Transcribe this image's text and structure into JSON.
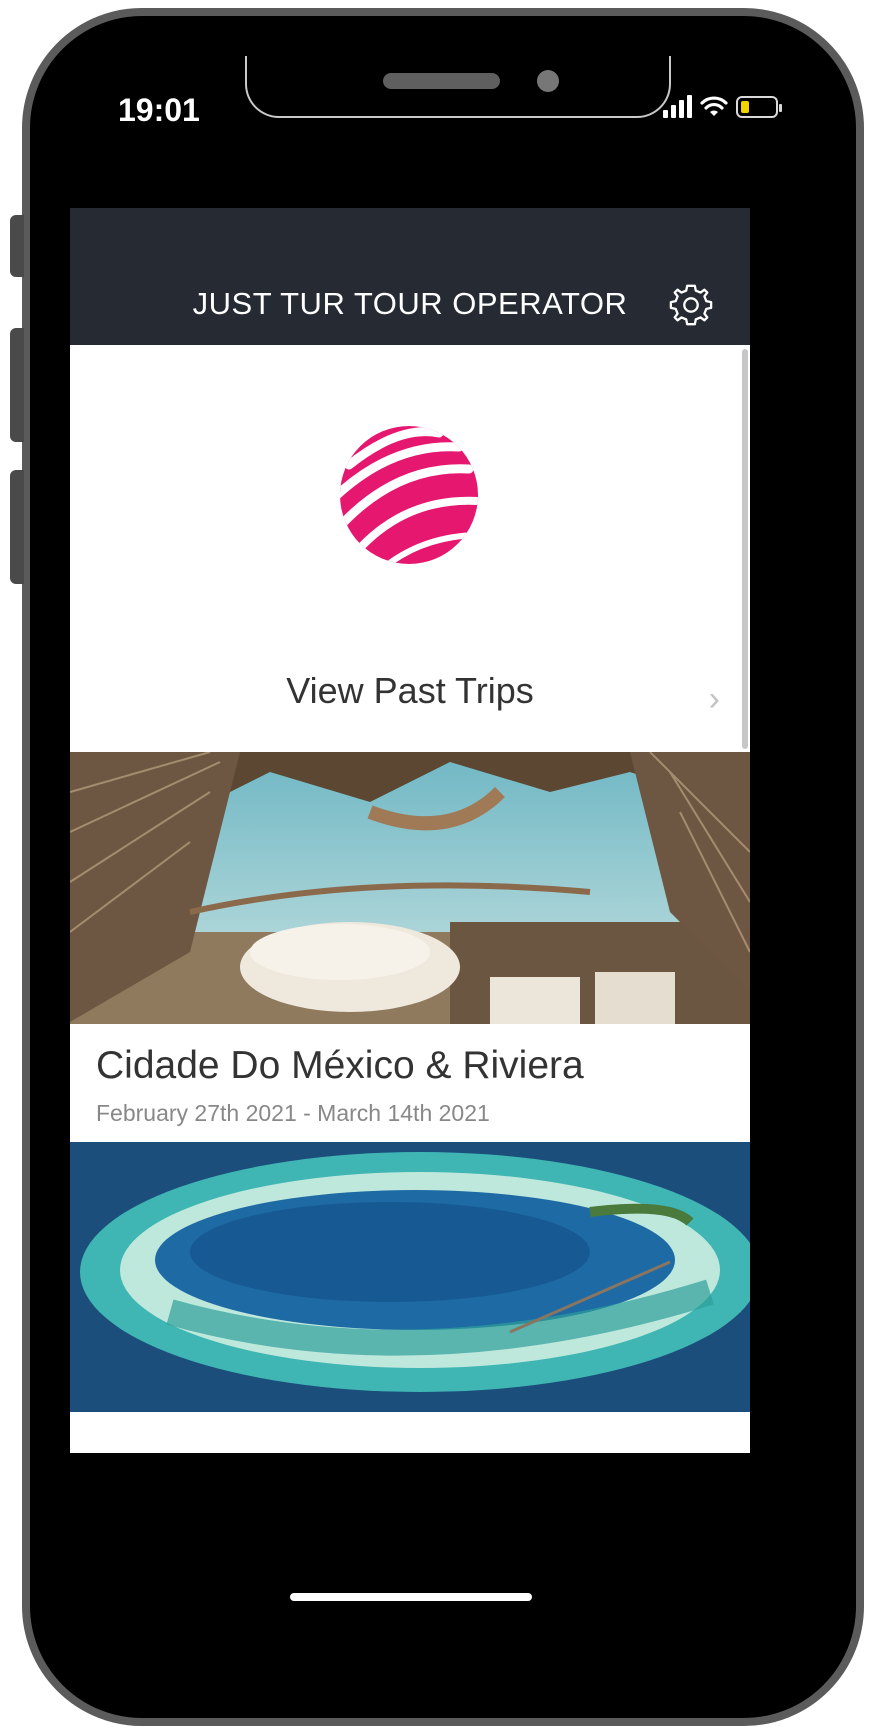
{
  "status_bar": {
    "time": "19:01",
    "icons": [
      "cellular-signal-icon",
      "wifi-icon",
      "battery-icon"
    ]
  },
  "header": {
    "title": "JUST TUR TOUR OPERATOR",
    "settings_icon": "gear-icon"
  },
  "logo": {
    "icon": "brand-sphere-logo-icon",
    "color": "#e5176f"
  },
  "past_trips": {
    "label": "View Past Trips",
    "chevron": "›"
  },
  "trips": [
    {
      "title": "Cidade Do México & Riviera",
      "dates": "February 27th 2021 - March 14th 2021",
      "image_icon": "beach-treehouse-photo"
    },
    {
      "image_icon": "atoll-aerial-photo"
    }
  ],
  "colors": {
    "header_bg": "#252a33",
    "brand_pink": "#e5176f"
  }
}
